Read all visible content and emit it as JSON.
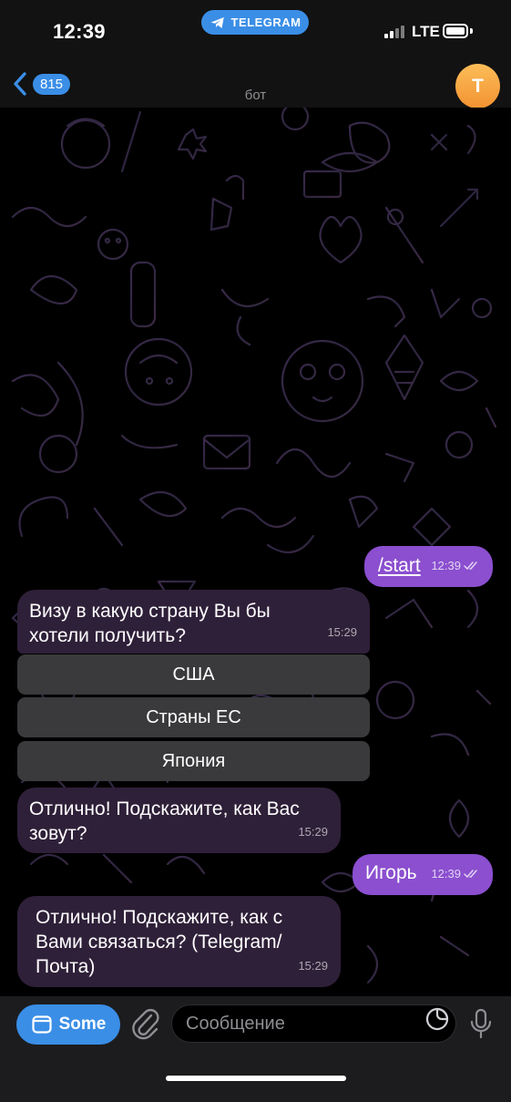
{
  "status_bar": {
    "time": "12:39",
    "app_pill": "TELEGRAM",
    "network": "LTE"
  },
  "nav": {
    "unread_count": "815",
    "title": "бот",
    "avatar_letter": "T"
  },
  "messages": [
    {
      "direction": "out",
      "text": "/start",
      "time": "12:39",
      "is_command": true
    },
    {
      "direction": "in",
      "text": "Визу в какую страну Вы бы хотели получить?",
      "time": "15:29"
    },
    {
      "direction": "in",
      "text": "Отлично! Подскажите, как Вас зовут?",
      "time": "15:29"
    },
    {
      "direction": "out",
      "text": "Игорь",
      "time": "12:39"
    },
    {
      "direction": "in",
      "text": "Отлично! Подскажите, как с Вами связаться? (Telegram/Почта)",
      "time": "15:29"
    }
  ],
  "keyboard_buttons": [
    "США",
    "Страны ЕС",
    "Япония"
  ],
  "input_bar": {
    "menu_label": "Some",
    "placeholder": "Сообщение"
  },
  "colors": {
    "accent": "#3a8ee6",
    "outgoing_bubble": "#8b4fcf",
    "incoming_bubble": "#2f2039",
    "keyboard_button": "#3a3a3c"
  },
  "icons": {
    "back": "chevron-left-icon",
    "pill": "telegram-plane-icon",
    "menu": "bot-menu-icon",
    "attach": "paperclip-icon",
    "sticker": "sticker-icon",
    "mic": "microphone-icon",
    "read": "double-check-icon"
  }
}
